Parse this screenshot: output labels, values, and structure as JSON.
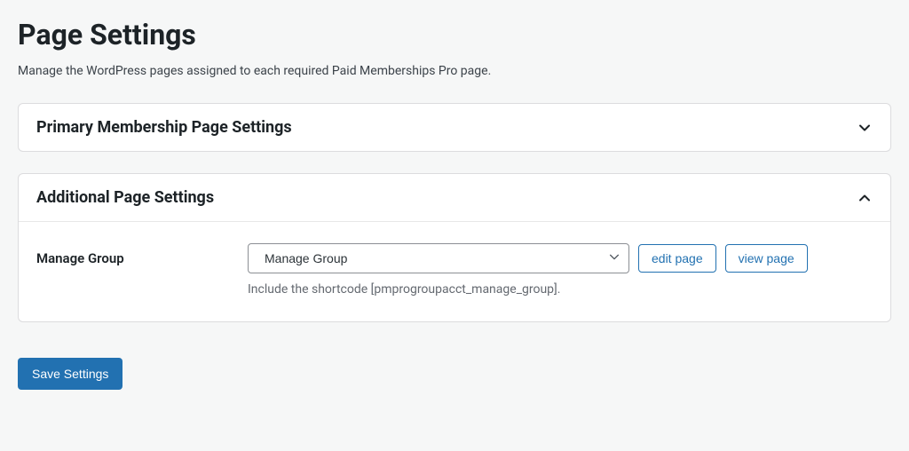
{
  "header": {
    "title": "Page Settings",
    "description": "Manage the WordPress pages assigned to each required Paid Memberships Pro page."
  },
  "panels": {
    "primary": {
      "title": "Primary Membership Page Settings"
    },
    "additional": {
      "title": "Additional Page Settings",
      "row": {
        "label": "Manage Group",
        "selected": "Manage Group",
        "edit_label": "edit page",
        "view_label": "view page",
        "help": "Include the shortcode [pmprogroupacct_manage_group]."
      }
    }
  },
  "actions": {
    "save": "Save Settings"
  }
}
